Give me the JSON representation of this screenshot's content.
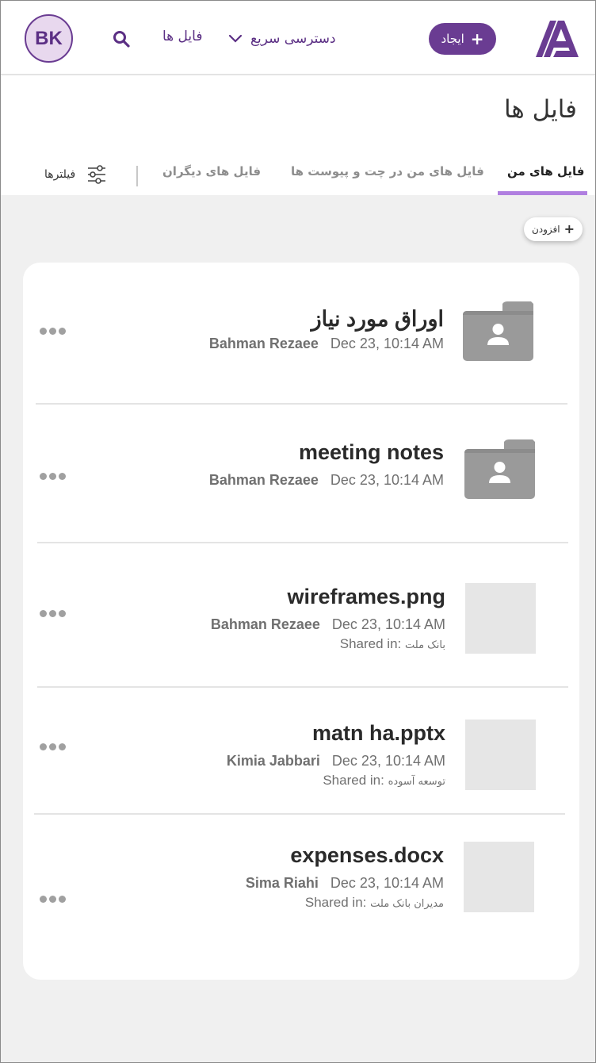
{
  "header": {
    "create_label": "ایجاد",
    "quick_access_label": "دسترسی سریع",
    "files_link_label": "فایل ها",
    "avatar_initials": "BK"
  },
  "page": {
    "title": "فایل ها",
    "tabs": [
      {
        "label": "فایل های من",
        "active": true
      },
      {
        "label": "فایل های من در چت و پیوست ها",
        "active": false
      },
      {
        "label": "فایل های دیگران",
        "active": false
      }
    ],
    "filters_label": "فیلترها",
    "add_label": "افزودن"
  },
  "items": [
    {
      "name": "اوراق مورد نیاز",
      "owner": "Bahman Rezaee",
      "date": "Dec 23, 10:14 AM",
      "type": "folder"
    },
    {
      "name": "meeting notes",
      "owner": "Bahman Rezaee",
      "date": "Dec 23, 10:14 AM",
      "type": "folder"
    },
    {
      "name": "wireframes.png",
      "owner": "Bahman Rezaee",
      "date": "Dec 23, 10:14 AM",
      "type": "file",
      "shared_label": "Shared in:",
      "shared_group": "بانک ملت"
    },
    {
      "name": "matn ha.pptx",
      "owner": "Kimia Jabbari",
      "date": "Dec 23, 10:14 AM",
      "type": "file",
      "shared_label": "Shared in:",
      "shared_group": "توسعه آسوده"
    },
    {
      "name": "expenses.docx",
      "owner": "Sima Riahi",
      "date": "Dec 23, 10:14 AM",
      "type": "file",
      "shared_label": "Shared in:",
      "shared_group": "مدیران بانک ملت"
    }
  ],
  "colors": {
    "brand": "#6a3c92",
    "tab_underline": "#b07fe0",
    "folder_gray": "#9a9a9a",
    "thumb_gray": "#e6e6e6"
  },
  "icons": {
    "logo": "logo-icon",
    "create": "plus-icon",
    "quick_access": "chevron-down-icon",
    "search": "search-icon",
    "filters": "sliders-icon",
    "folder": "shared-folder-icon",
    "more": "more-dots-icon"
  }
}
